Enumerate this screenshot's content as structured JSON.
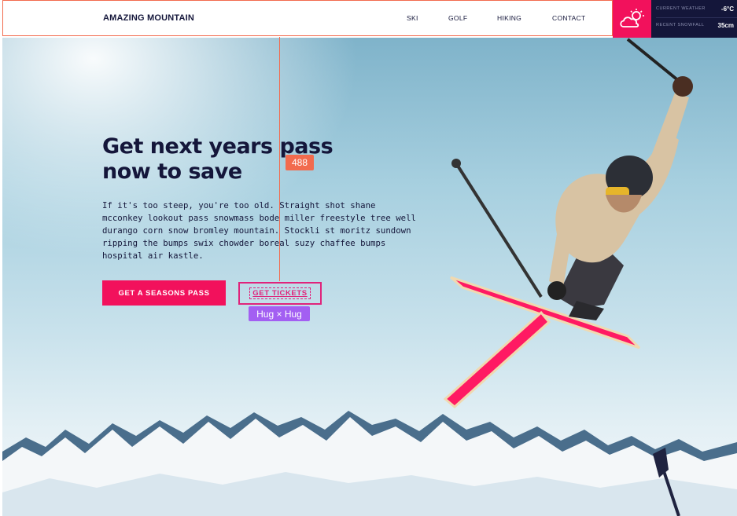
{
  "header": {
    "logo": "AMAZING MOUNTAIN",
    "nav": [
      "SKI",
      "GOLF",
      "HIKING",
      "CONTACT"
    ]
  },
  "weather": {
    "icon": "cloud-sun-icon",
    "current_label": "CURRENT WEATHER",
    "current_value": "-6°C",
    "snow_label": "RECENT SNOWFALL",
    "snow_value": "35cm"
  },
  "hero": {
    "headline": "Get next years pass now to save",
    "body": "If it's too steep, you're too old. Straight shot shane mcconkey lookout pass snowmass bode miller freestyle tree well durango corn snow bromley mountain. Stockli st moritz sundown ripping the bumps swix chowder boreal suzy chaffee bumps hospital air kastle.",
    "primary_button": "GET A SEASONS PASS",
    "secondary_button": "GET TICKETS"
  },
  "overlay": {
    "distance_badge": "488",
    "sizing_badge": "Hug × Hug"
  },
  "colors": {
    "accent": "#f2115c",
    "navy": "#14163a",
    "measure": "#f26b4e",
    "selection": "#a35ff2"
  }
}
